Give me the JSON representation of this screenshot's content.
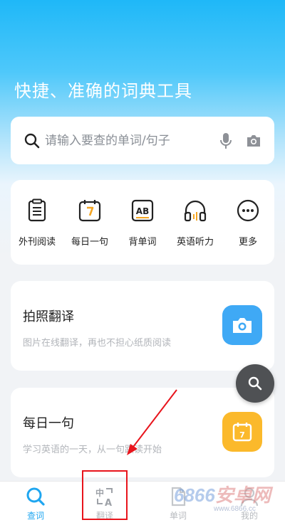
{
  "hero": {
    "title": "快捷、准确的词典工具"
  },
  "search": {
    "placeholder": "请输入要查的单词/句子",
    "icon": "search-icon",
    "mic_icon": "microphone-icon",
    "camera_icon": "camera-icon"
  },
  "tools": [
    {
      "label": "外刊阅读",
      "icon": "clipboard-icon"
    },
    {
      "label": "每日一句",
      "icon": "calendar-icon"
    },
    {
      "label": "背单词",
      "icon": "ab-card-icon"
    },
    {
      "label": "英语听力",
      "icon": "headphones-icon"
    },
    {
      "label": "更多",
      "icon": "more-dots-icon"
    }
  ],
  "features": [
    {
      "title": "拍照翻译",
      "subtitle": "图片在线翻译，再也不担心纸质阅读",
      "icon": "camera-icon",
      "color": "#3fa9f5"
    },
    {
      "title": "每日一句",
      "subtitle": "学习英语的一天，从一句跟读开始",
      "icon": "calendar-icon",
      "color": "#fbb92b",
      "icon_text": "7"
    }
  ],
  "tabbar": {
    "tabs": [
      {
        "label": "查词",
        "icon": "search-icon",
        "active": true
      },
      {
        "label": "翻译",
        "icon": "translate-icon",
        "active": false
      },
      {
        "label": "单词",
        "icon": "document-icon",
        "active": false
      },
      {
        "label": "我的",
        "icon": "user-icon",
        "active": false
      }
    ]
  },
  "watermark": {
    "brand_num": "6866",
    "brand_cn": "安卓网",
    "url": "www.6866.cc"
  },
  "colors": {
    "accent": "#1fa6f0",
    "annotation": "#e8141c",
    "floating_button": "#4f5154"
  }
}
